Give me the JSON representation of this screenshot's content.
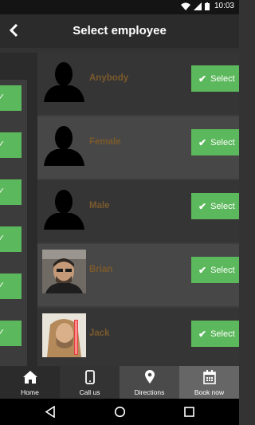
{
  "status": {
    "time": "10:03"
  },
  "header": {
    "title": "Select employee"
  },
  "employees": [
    {
      "name": "Anybody",
      "select_label": "Select",
      "photo": "silhouette"
    },
    {
      "name": "Female",
      "select_label": "Select",
      "photo": "silhouette"
    },
    {
      "name": "Male",
      "select_label": "Select",
      "photo": "silhouette"
    },
    {
      "name": "Brian",
      "select_label": "Select",
      "photo": "portrait-brian"
    },
    {
      "name": "Jack",
      "select_label": "Select",
      "photo": "portrait-jack"
    }
  ],
  "nav": [
    {
      "label": "Home",
      "icon": "home-icon"
    },
    {
      "label": "Call us",
      "icon": "phone-icon"
    },
    {
      "label": "Directions",
      "icon": "map-pin-icon"
    },
    {
      "label": "Book now",
      "icon": "calendar-icon"
    }
  ],
  "colors": {
    "select_green": "#5cb85c",
    "name_text": "#7a5a2c",
    "nav_home_bg": "#2b2b2b",
    "nav_call_bg": "#333333",
    "nav_directions_bg": "#4a4a4a",
    "nav_book_bg": "#666666"
  }
}
